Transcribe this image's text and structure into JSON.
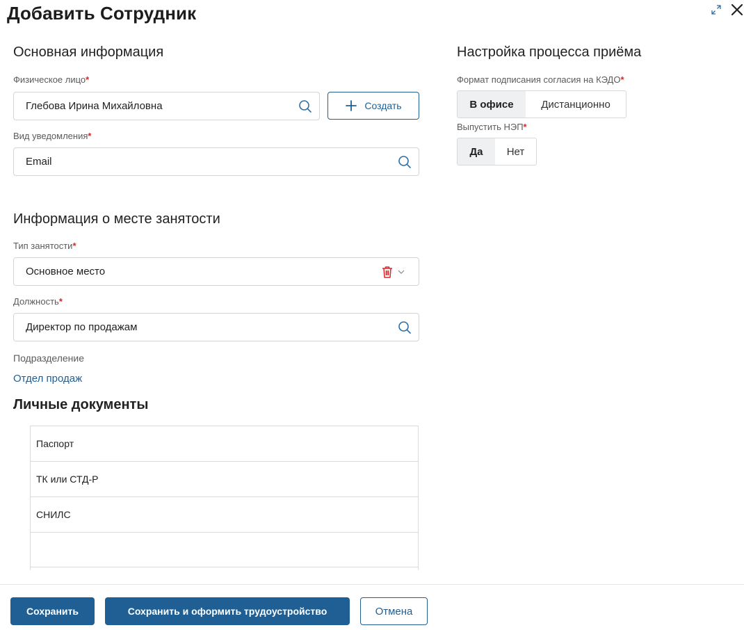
{
  "dialog": {
    "title": "Добавить Сотрудник"
  },
  "basic_info": {
    "title": "Основная информация",
    "person": {
      "label": "Физическое лицо",
      "required_mark": "*",
      "value": "Глебова Ирина Михайловна",
      "create_label": "Создать"
    },
    "notification": {
      "label": "Вид уведомления",
      "required_mark": "*",
      "value": "Email"
    }
  },
  "hiring_setup": {
    "title": "Настройка процесса приёма",
    "signing_format": {
      "label": "Формат подписания согласия на КЭДО",
      "required_mark": "*",
      "options": [
        "В офисе",
        "Дистанционно"
      ],
      "selected": "В офисе"
    },
    "issue_nep": {
      "label": "Выпустить НЭП",
      "required_mark": "*",
      "options": [
        "Да",
        "Нет"
      ],
      "selected": "Да"
    }
  },
  "employment": {
    "title": "Информация о месте занятости",
    "type": {
      "label": "Тип занятости",
      "required_mark": "*",
      "value": "Основное место"
    },
    "position": {
      "label": "Должность",
      "required_mark": "*",
      "value": "Директор по продажам"
    },
    "department": {
      "label": "Подразделение",
      "value": "Отдел продаж"
    }
  },
  "documents": {
    "title": "Личные документы",
    "rows": [
      "Паспорт",
      "ТК или СТД-Р",
      "СНИЛС",
      ""
    ]
  },
  "footer": {
    "save": "Сохранить",
    "save_and_hire": "Сохранить и оформить трудоустройство",
    "cancel": "Отмена"
  },
  "colors": {
    "accent": "#1f5f94",
    "required": "#d8262b",
    "delete_icon": "#d8262b"
  },
  "icons": {
    "expand": "expand-icon",
    "close": "close-icon",
    "search": "search-icon",
    "plus": "plus-icon",
    "trash": "trash-icon",
    "chevron": "chevron-down-icon"
  }
}
